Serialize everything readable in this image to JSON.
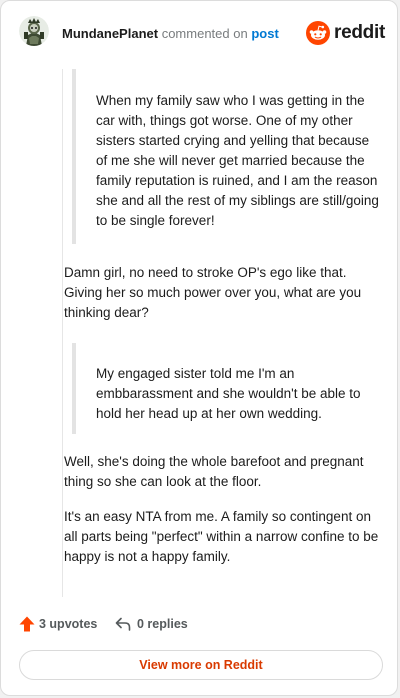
{
  "header": {
    "author": "MundanePlanet",
    "commented_on": "commented on",
    "post_link": "post",
    "brand": "reddit"
  },
  "comment": {
    "quote1": "When my family saw who I was getting in the car with, things got worse. One of my other sisters started crying and yelling that because of me she will never get married because the family reputation is ruined, and I am the reason she and all the rest of my siblings are still/going to be single forever!",
    "para1": "Damn girl, no need to stroke OP's ego like that. Giving her so much power over you, what are you thinking dear?",
    "quote2": "My engaged sister told me I'm an embbarassment and she wouldn't be able to hold her head up at her own wedding.",
    "para2": "Well, she's doing the whole barefoot and pregnant thing so she can look at the floor.",
    "para3": "It's an easy NTA from me. A family so contingent on all parts being \"perfect\" within a narrow confine to be happy is not a happy family."
  },
  "footer": {
    "upvotes": "3 upvotes",
    "replies": "0 replies"
  },
  "actions": {
    "view_more": "View more on Reddit"
  },
  "colors": {
    "reddit_orange": "#ff4500",
    "link_blue": "#0079d3",
    "view_more_text": "#d93a00"
  },
  "icons": {
    "avatar": "snoo-avatar",
    "brand": "reddit-logo-icon",
    "upvote": "upvote-arrow-icon",
    "reply": "reply-arrow-icon"
  }
}
